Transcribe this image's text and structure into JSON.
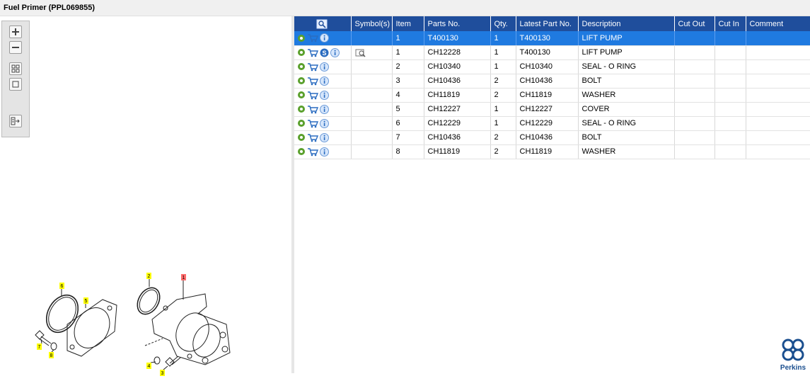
{
  "window": {
    "title": "Fuel Primer (PPL069855)"
  },
  "toolbar": {
    "buttons": [
      {
        "icon": "zoom-in-icon"
      },
      {
        "icon": "zoom-out-icon"
      },
      {
        "icon": "fit-view-icon"
      },
      {
        "icon": "actual-size-icon"
      },
      {
        "icon": "export-icon"
      }
    ]
  },
  "diagram": {
    "callouts": [
      "1",
      "2",
      "3",
      "4",
      "5",
      "6",
      "7",
      "8"
    ]
  },
  "grid": {
    "columns": [
      "",
      "Symbol(s)",
      "Item",
      "Parts No.",
      "Qty.",
      "Latest Part No.",
      "Description",
      "Cut Out",
      "Cut In",
      "Comment"
    ],
    "rows": [
      {
        "item": "1",
        "parts_no": "T400130",
        "qty": "1",
        "latest": "T400130",
        "desc": "LIFT PUMP",
        "selected": true
      },
      {
        "item": "1",
        "parts_no": "CH12228",
        "qty": "1",
        "latest": "T400130",
        "desc": "LIFT PUMP",
        "selected": false
      },
      {
        "item": "2",
        "parts_no": "CH10340",
        "qty": "1",
        "latest": "CH10340",
        "desc": "SEAL - O RING",
        "selected": false
      },
      {
        "item": "3",
        "parts_no": "CH10436",
        "qty": "2",
        "latest": "CH10436",
        "desc": "BOLT",
        "selected": false
      },
      {
        "item": "4",
        "parts_no": "CH11819",
        "qty": "2",
        "latest": "CH11819",
        "desc": "WASHER",
        "selected": false
      },
      {
        "item": "5",
        "parts_no": "CH12227",
        "qty": "1",
        "latest": "CH12227",
        "desc": "COVER",
        "selected": false
      },
      {
        "item": "6",
        "parts_no": "CH12229",
        "qty": "1",
        "latest": "CH12229",
        "desc": "SEAL - O RING",
        "selected": false
      },
      {
        "item": "7",
        "parts_no": "CH10436",
        "qty": "2",
        "latest": "CH10436",
        "desc": "BOLT",
        "selected": false
      },
      {
        "item": "8",
        "parts_no": "CH11819",
        "qty": "2",
        "latest": "CH11819",
        "desc": "WASHER",
        "selected": false
      }
    ]
  },
  "brand": {
    "name": "Perkins"
  },
  "colors": {
    "header": "#1f4e9c",
    "selection": "#1f7ae0",
    "callout": "#ffff00",
    "callout_highlight": "#ff6b6b"
  }
}
